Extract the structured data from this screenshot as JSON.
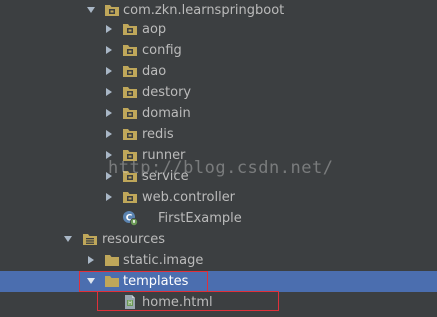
{
  "tree": {
    "package_root": {
      "label": "com.zkn.learnspringboot",
      "expanded": true
    },
    "packages": [
      {
        "label": "aop"
      },
      {
        "label": "config"
      },
      {
        "label": "dao"
      },
      {
        "label": "destory"
      },
      {
        "label": "domain"
      },
      {
        "label": "redis"
      },
      {
        "label": "runner"
      },
      {
        "label": "service"
      },
      {
        "label": "web.controller"
      }
    ],
    "class_file": {
      "label": "FirstExample",
      "icon": "spring-boot-class-icon"
    },
    "resources": {
      "label": "resources",
      "expanded": true
    },
    "static_image": {
      "label": "static.image"
    },
    "templates": {
      "label": "templates",
      "expanded": true,
      "selected": true
    },
    "home_html": {
      "label": "home.html",
      "icon": "html-file-icon"
    }
  },
  "watermark": "http://blog.csdn.net/",
  "colors": {
    "background": "#3c3f41",
    "selection": "#4b6eaf",
    "folder": "#bfa75a",
    "highlight_border": "#e0303a",
    "text": "#bbbbbb"
  }
}
